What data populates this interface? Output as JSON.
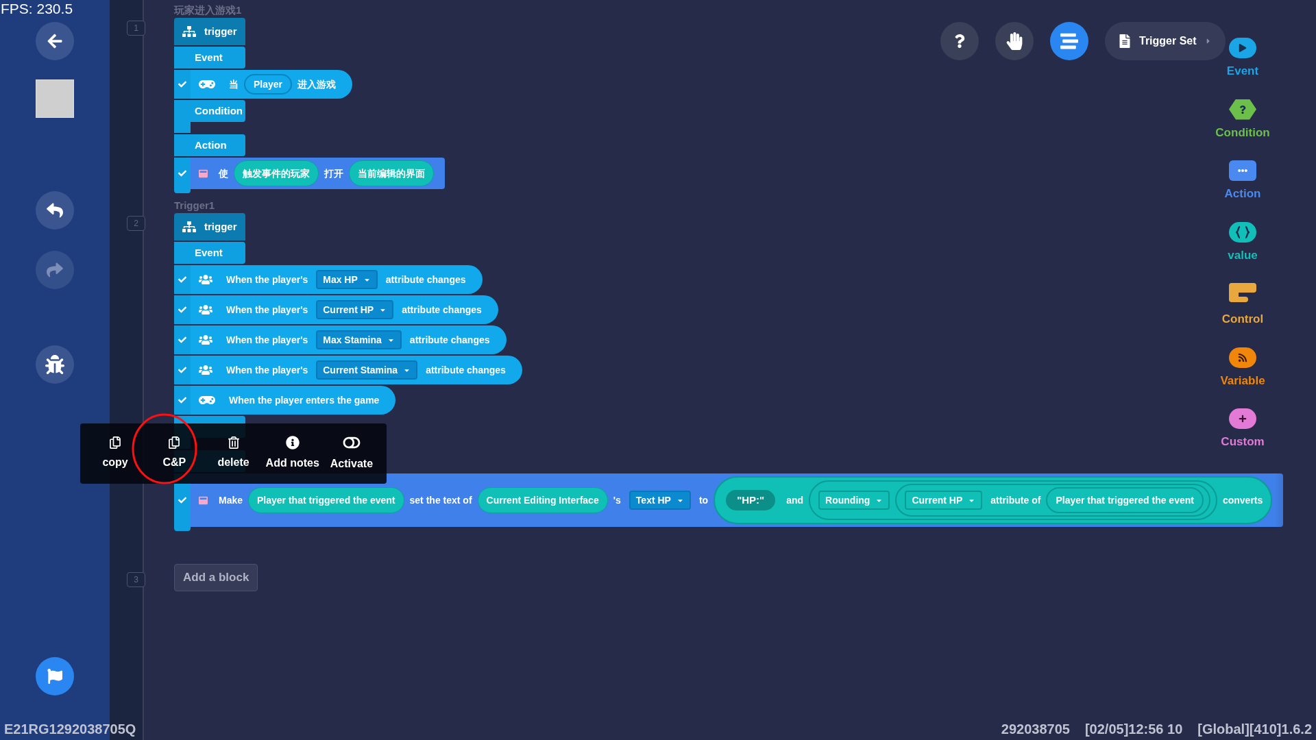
{
  "fps": "FPS: 230.5",
  "toolbar": {
    "tools": [
      {
        "kind": "help",
        "selected": false
      },
      {
        "kind": "hand",
        "selected": false
      },
      {
        "kind": "outline",
        "selected": true
      }
    ],
    "trigger_set": "Trigger Set"
  },
  "palette": [
    {
      "kind": "event",
      "label": "Event",
      "color": "#1aa6e6"
    },
    {
      "kind": "condition",
      "label": "Condition",
      "color": "#6cc04a"
    },
    {
      "kind": "action",
      "label": "Action",
      "color": "#4a8af0"
    },
    {
      "kind": "value",
      "label": "value",
      "color": "#12bfb8"
    },
    {
      "kind": "control",
      "label": "Control",
      "color": "#e8a83e"
    },
    {
      "kind": "variable",
      "label": "Variable",
      "color": "#f0860a"
    },
    {
      "kind": "custom",
      "label": "Custom",
      "color": "#e27ad6"
    }
  ],
  "triggers": [
    {
      "number": "1",
      "title": "玩家进入游戏1",
      "header": "trigger",
      "event_label": "Event",
      "condition_label": "Condition",
      "action_label": "Action",
      "events": [
        {
          "kind": "enter",
          "checked": true,
          "parts": [
            {
              "kind": "text",
              "text": "当"
            },
            {
              "kind": "slot",
              "text": "Player"
            },
            {
              "kind": "text",
              "text": "进入游戏"
            }
          ]
        }
      ],
      "actions": [
        {
          "kind": "ui",
          "checked": true,
          "parts": [
            {
              "kind": "text",
              "text": "使"
            },
            {
              "kind": "pill",
              "text": "触发事件的玩家"
            },
            {
              "kind": "text",
              "text": "打开"
            },
            {
              "kind": "pill",
              "text": "当前编辑的界面"
            }
          ]
        }
      ]
    },
    {
      "number": "2",
      "title": "Trigger1",
      "header": "trigger",
      "event_label": "Event",
      "events": [
        {
          "kind": "attribute",
          "checked": true,
          "parts": [
            {
              "kind": "text",
              "text": "When the player's"
            },
            {
              "kind": "dropdown",
              "text": "Max HP"
            },
            {
              "kind": "text",
              "text": "attribute changes"
            }
          ]
        },
        {
          "kind": "attribute",
          "checked": true,
          "parts": [
            {
              "kind": "text",
              "text": "When the player's"
            },
            {
              "kind": "dropdown",
              "text": "Current HP"
            },
            {
              "kind": "text",
              "text": "attribute changes"
            }
          ]
        },
        {
          "kind": "attribute",
          "checked": true,
          "parts": [
            {
              "kind": "text",
              "text": "When the player's"
            },
            {
              "kind": "dropdown",
              "text": "Max Stamina"
            },
            {
              "kind": "text",
              "text": "attribute changes"
            }
          ]
        },
        {
          "kind": "attribute",
          "checked": true,
          "parts": [
            {
              "kind": "text",
              "text": "When the player's"
            },
            {
              "kind": "dropdown",
              "text": "Current Stamina"
            },
            {
              "kind": "text",
              "text": "attribute changes"
            }
          ]
        },
        {
          "kind": "enter",
          "checked": true,
          "parts": [
            {
              "kind": "text",
              "text": "When the player enters the game"
            }
          ]
        }
      ],
      "actions": [
        {
          "kind": "ui",
          "checked": true,
          "parts": [
            {
              "kind": "text",
              "text": "Make"
            },
            {
              "kind": "pill",
              "text": "Player that triggered the event"
            },
            {
              "kind": "text",
              "text": "set the text of"
            },
            {
              "kind": "pill",
              "text": "Current Editing Interface"
            },
            {
              "kind": "text",
              "text": "'s"
            },
            {
              "kind": "dropdown",
              "text": "Text HP"
            },
            {
              "kind": "text",
              "text": "to"
            },
            {
              "kind": "group",
              "children": [
                {
                  "kind": "string",
                  "text": "\"HP:\""
                },
                {
                  "kind": "text",
                  "text": "and"
                },
                {
                  "kind": "group",
                  "children": [
                    {
                      "kind": "dropdown",
                      "text": "Rounding"
                    },
                    {
                      "kind": "group",
                      "children": [
                        {
                          "kind": "dropdown",
                          "text": "Current HP"
                        },
                        {
                          "kind": "text",
                          "text": "attribute of"
                        },
                        {
                          "kind": "slot",
                          "text": "Player that triggered the event"
                        }
                      ]
                    }
                  ]
                },
                {
                  "kind": "text",
                  "text": "converts"
                }
              ]
            }
          ]
        }
      ]
    }
  ],
  "add_block": {
    "number": "3",
    "label": "Add a block"
  },
  "context_menu": [
    {
      "kind": "copy",
      "label": "copy"
    },
    {
      "kind": "copy_paste",
      "label": "C&P"
    },
    {
      "kind": "delete",
      "label": "delete"
    },
    {
      "kind": "notes",
      "label": "Add notes"
    },
    {
      "kind": "activate",
      "label": "Activate"
    }
  ],
  "status": {
    "device_id": "E21RG1292038705Q",
    "user_id": "292038705",
    "timestamp": "[02/05]12:56 10",
    "version": "[Global][410]1.6.2"
  }
}
